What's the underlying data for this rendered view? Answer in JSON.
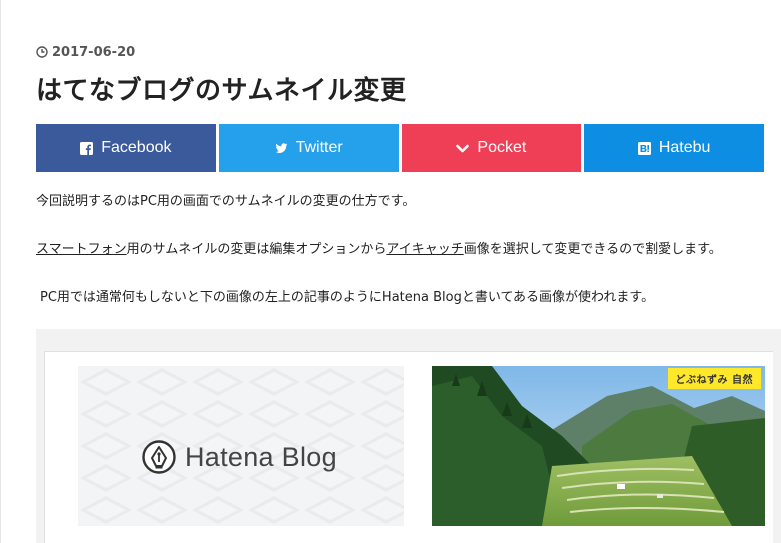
{
  "post": {
    "date": "2017-06-20",
    "title": "はてなブログのサムネイル変更"
  },
  "share": {
    "facebook": "Facebook",
    "twitter": "Twitter",
    "pocket": "Pocket",
    "hatebu": "Hatebu"
  },
  "colors": {
    "facebook": "#3a5a9b",
    "twitter": "#25a1ec",
    "pocket": "#ef3f56",
    "hatebu": "#0d8ee3",
    "badge": "#ffe82a"
  },
  "body": {
    "p1": "今回説明するのはPC用の画面でのサムネイルの変更の仕方です。",
    "p2_link1": "スマートフォン",
    "p2_mid": "用のサムネイルの変更は編集オプションから",
    "p2_link2": "アイキャッチ",
    "p2_end": "画像を選択して変更できるので割愛します。",
    "p3": "PC用では通常何もしないと下の画像の左上の記事のようにHatena Blogと書いてある画像が使われます。"
  },
  "figure": {
    "logo_text": "Hatena Blog",
    "badge": "どぶねずみ 自然"
  },
  "icons": {
    "date": "clock-icon",
    "facebook": "facebook-icon",
    "twitter": "twitter-icon",
    "pocket": "pocket-chevron-icon",
    "hatebu": "hatena-b-icon",
    "logo": "fountain-pen-nib-icon"
  }
}
